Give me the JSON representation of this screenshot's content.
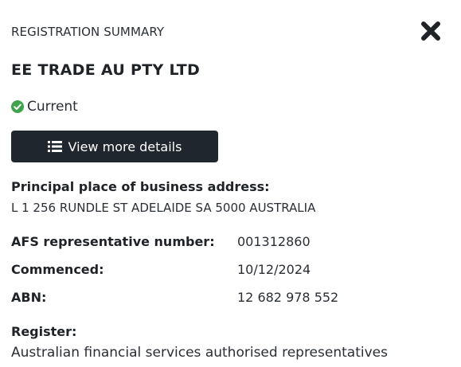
{
  "header": {
    "title": "REGISTRATION SUMMARY",
    "close_icon": "close-x-icon"
  },
  "company": {
    "name": "EE TRADE AU PTY LTD",
    "status": "Current",
    "status_icon": "check-circle-icon",
    "status_color": "#3fa34d"
  },
  "actions": {
    "view_more_label": "View more details",
    "view_more_icon": "list-icon",
    "button_color": "#1f262e"
  },
  "address": {
    "label": "Principal place of business address:",
    "value": "L 1 256 RUNDLE ST ADELAIDE SA 5000 AUSTRALIA"
  },
  "details": [
    {
      "label": "AFS representative number:",
      "value": "001312860"
    },
    {
      "label": "Commenced:",
      "value": "10/12/2024"
    },
    {
      "label": "ABN:",
      "value": "12 682 978 552"
    }
  ],
  "register": {
    "label": "Register:",
    "value": "Australian financial services authorised representatives"
  }
}
